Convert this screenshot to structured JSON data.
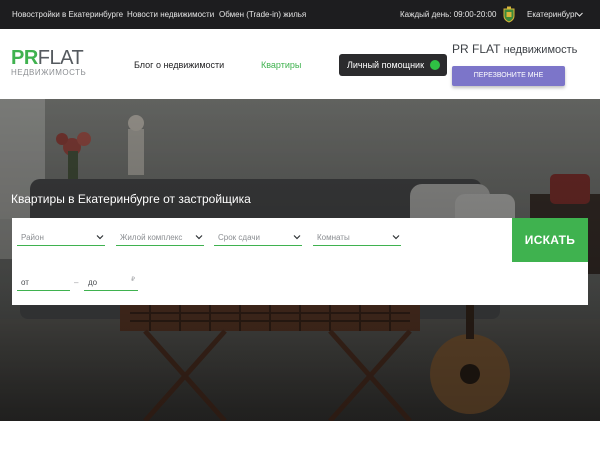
{
  "topbar": {
    "links": [
      {
        "label": "Новостройки в Екатеринбурге"
      },
      {
        "label": "Новости недвижимости"
      },
      {
        "label": "Обмен (Trade-in) жилья"
      }
    ],
    "hours": "Каждый день: 09:00-20:00",
    "city": "Екатеринбург",
    "city_icon": "chevron-down-icon",
    "crest_icon": "city-crest-icon"
  },
  "header": {
    "logo_pr": "PR",
    "logo_flat": "FLAT",
    "logo_sub": "НЕДВИЖИМОСТЬ",
    "nav": [
      {
        "label": "Блог о недвижимости",
        "active": false
      },
      {
        "label": "Квартиры",
        "active": true
      }
    ],
    "assistant_label": "Личный помощник",
    "assistant_status_color": "#2fc244",
    "brand_name": "PR FLAT",
    "brand_suffix": "недвижимость",
    "callback_label": "ПЕРЕЗВОНИТЕ МНЕ"
  },
  "hero": {
    "title": "Квартиры в Екатеринбурге от застройщика"
  },
  "filter": {
    "selects": [
      {
        "placeholder": "Район"
      },
      {
        "placeholder": "Жилой комплекс"
      },
      {
        "placeholder": "Срок сдачи"
      },
      {
        "placeholder": "Комнаты"
      }
    ],
    "price_from": "от",
    "price_to": "до",
    "range_dash": "–",
    "currency": "₽",
    "search_label": "ИСКАТЬ"
  },
  "colors": {
    "accent_green": "#3fb24f",
    "topbar_bg": "#1d1d1f",
    "callback_bg": "#7c75c9"
  }
}
